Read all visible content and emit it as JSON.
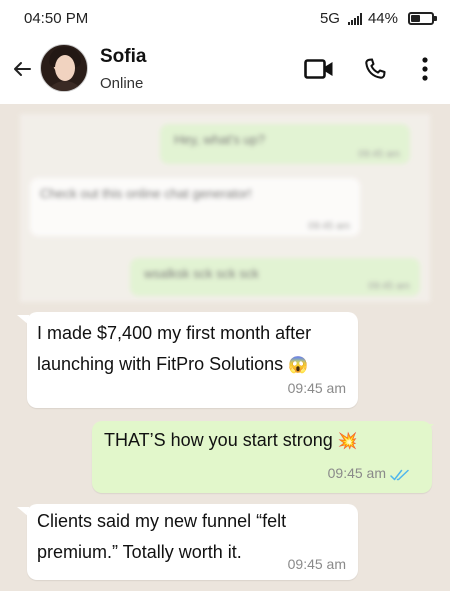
{
  "status_bar": {
    "time": "04:50 PM",
    "network": "5G",
    "battery": "44%",
    "battery_level": 0.44
  },
  "header": {
    "contact_name": "Sofia",
    "contact_status": "Online",
    "icons": [
      "back-arrow-icon",
      "avatar",
      "video-call-icon",
      "phone-icon",
      "more-menu-icon"
    ]
  },
  "blurred_messages": [
    {
      "direction": "out",
      "text": "Hey, what's up?",
      "time": "09:45 am"
    },
    {
      "direction": "in",
      "text": "Check out this online chat generator!",
      "time": "09:45 am"
    },
    {
      "direction": "out",
      "text": "wsalksk sck sck sck",
      "time": "09:45 am"
    }
  ],
  "messages": [
    {
      "direction": "in",
      "line1": "I made $7,400 my first month after",
      "line2": "launching with FitPro Solutions",
      "emoji": "😱",
      "time": "09:45 am"
    },
    {
      "direction": "out",
      "line1": "THAT’S how you start strong",
      "emoji": "💥",
      "time": "09:45 am",
      "read": true
    },
    {
      "direction": "in",
      "line1": "Clients said my new funnel “felt",
      "line2": "premium.” Totally worth it.",
      "time": "09:45 am"
    }
  ],
  "colors": {
    "chat_background": "#ece5dd",
    "incoming_bubble": "#ffffff",
    "outgoing_bubble": "#e2f7cb",
    "read_ticks": "#4fb6ec"
  }
}
